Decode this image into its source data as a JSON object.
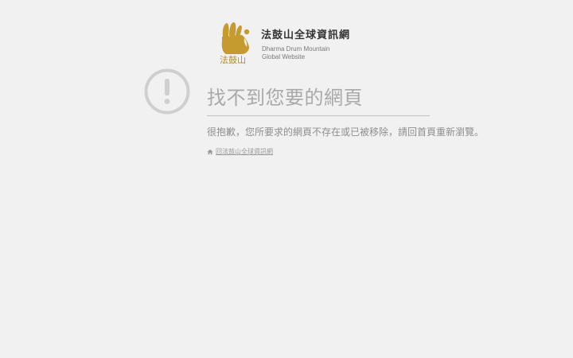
{
  "logo": {
    "name_cn": "法鼓山全球資訊網",
    "mark_text": "法鼓山",
    "name_en_line1": "Dharma Drum Mountain",
    "name_en_line2": "Global Website"
  },
  "error": {
    "icon": "exclamation-circle-icon",
    "title": "找不到您要的網頁",
    "message": "很抱歉，您所要求的網頁不存在或已被移除，請回首頁重新瀏覽。",
    "home_link_icon": "home-icon",
    "home_link_label": "回法鼓山全球資訊網"
  },
  "colors": {
    "background": "#f1f1f1",
    "brand_gold": "#b38a2a",
    "muted_text": "#a9a9a9"
  }
}
